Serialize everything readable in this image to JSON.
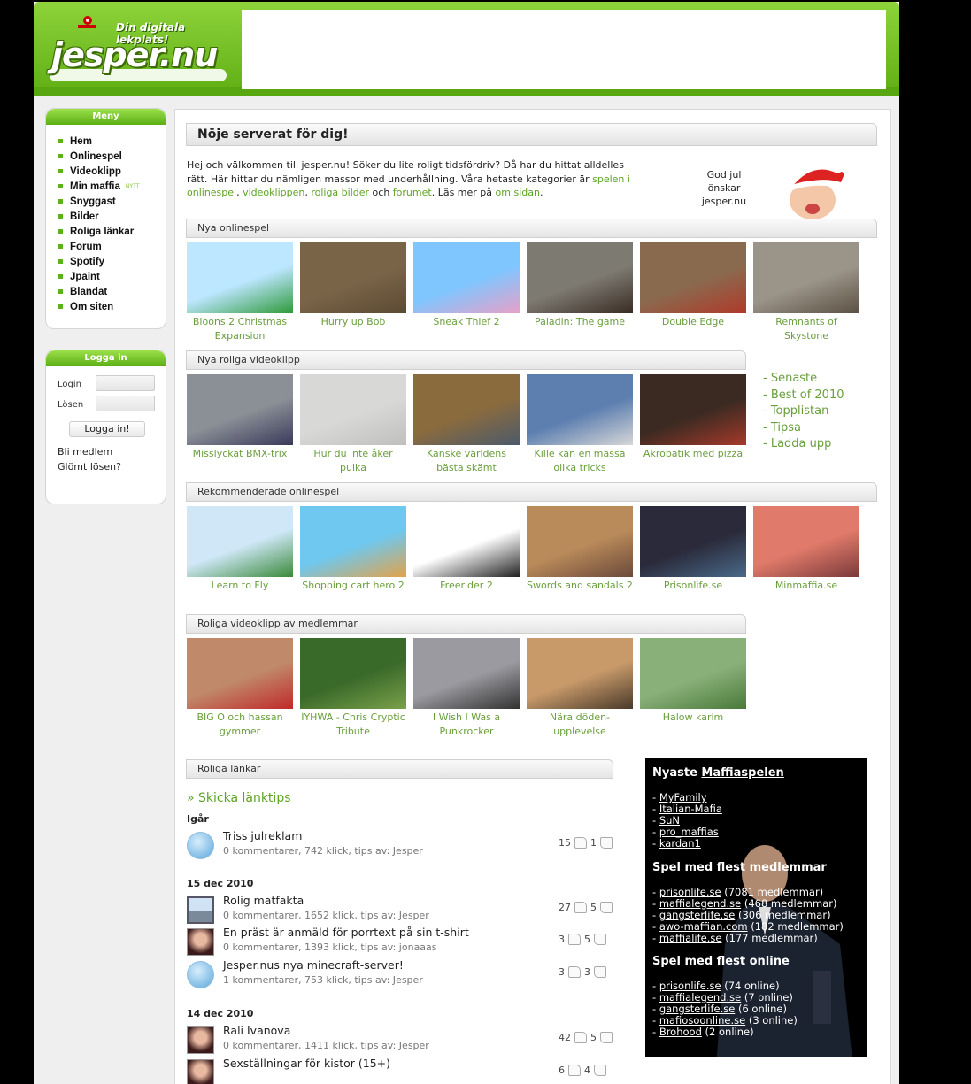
{
  "header": {
    "tagline": "Din digitala lekplats!",
    "logo_text": "jesper.nu"
  },
  "menu": {
    "title": "Meny",
    "items": [
      {
        "label": "Hem"
      },
      {
        "label": "Onlinespel"
      },
      {
        "label": "Videoklipp"
      },
      {
        "label": "Min maffia",
        "badge": "NYTT"
      },
      {
        "label": "Snyggast"
      },
      {
        "label": "Bilder"
      },
      {
        "label": "Roliga länkar"
      },
      {
        "label": "Forum"
      },
      {
        "label": "Spotify"
      },
      {
        "label": "Jpaint"
      },
      {
        "label": "Blandat"
      },
      {
        "label": "Om siten"
      }
    ]
  },
  "login": {
    "title": "Logga in",
    "login_label": "Login",
    "password_label": "Lösen",
    "submit": "Logga in!",
    "register": "Bli medlem",
    "forgot": "Glömt lösen?"
  },
  "main": {
    "title": "Nöje serverat för dig!",
    "intro_text_1": "Hej och välkommen till jesper.nu! Söker du lite roligt tidsfördriv? Då har du hittat alldelles rätt. Här hittar du nämligen massor med underhållning. Våra hetaste kategorier är ",
    "intro_links": [
      "spelen i onlinespel",
      "videoklippen",
      "roliga bilder",
      "forumet",
      "om sidan"
    ],
    "intro_sep_1": ", ",
    "intro_sep_2": ", ",
    "intro_sep_3": " och ",
    "intro_text_2": ". Läs mer på ",
    "intro_text_3": ".",
    "xmas_line1": "God jul",
    "xmas_line2": "önskar",
    "xmas_line3": "jesper.nu"
  },
  "sections": {
    "new_games": {
      "title": "Nya onlinespel",
      "items": [
        "Bloons 2 Christmas Expansion",
        "Hurry up Bob",
        "Sneak Thief 2",
        "Paladin: The game",
        "Double Edge",
        "Remnants of Skystone"
      ]
    },
    "new_videos": {
      "title": "Nya roliga videoklipp",
      "items": [
        "Misslyckat BMX-trix",
        "Hur du inte åker pulka",
        "Kanske världens bästa skämt",
        "Kille kan en massa olika tricks",
        "Akrobatik med pizza"
      ]
    },
    "recommended": {
      "title": "Rekommenderade onlinespel",
      "items": [
        "Learn to Fly",
        "Shopping cart hero 2",
        "Freerider 2",
        "Swords and sandals 2",
        "Prisonlife.se",
        "Minmaffia.se"
      ]
    },
    "member_videos": {
      "title": "Roliga videoklipp av medlemmar",
      "items": [
        "BIG O och hassan gymmer",
        "IYHWA - Chris Cryptic Tribute",
        "I Wish I Was a Punkrocker",
        "Nära döden-upplevelse",
        "Halow karim"
      ]
    }
  },
  "video_links": [
    "- Senaste",
    "- Best of 2010",
    "- Topplistan",
    "- Tipsa",
    "- Ladda upp"
  ],
  "links": {
    "title": "Roliga länkar",
    "tip": "» Skicka länktips",
    "days": [
      {
        "label": "Igår",
        "items": [
          {
            "title": "Triss julreklam",
            "meta": "0 kommentarer, 742 klick, tips av: Jesper",
            "up": "15",
            "down": "1",
            "icon": "globe"
          }
        ]
      },
      {
        "label": "15 dec 2010",
        "items": [
          {
            "title": "Rolig matfakta",
            "meta": "0 kommentarer, 1652 klick, tips av: Jesper",
            "up": "27",
            "down": "5",
            "icon": "picture"
          },
          {
            "title": "En präst är anmäld för porrtext på sin t-shirt",
            "meta": "0 kommentarer, 1393 klick, tips av: jonaaas",
            "up": "3",
            "down": "5",
            "icon": "avatar"
          },
          {
            "title": "Jesper.nus nya minecraft-server!",
            "meta": "1 kommentarer, 753 klick, tips av: Jesper",
            "up": "3",
            "down": "3",
            "icon": "globe"
          }
        ]
      },
      {
        "label": "14 dec 2010",
        "items": [
          {
            "title": "Rali Ivanova",
            "meta": "0 kommentarer, 1411 klick, tips av: Jesper",
            "up": "42",
            "down": "5",
            "icon": "avatar"
          },
          {
            "title": "Sexställningar för kistor (15+)",
            "meta": "",
            "up": "6",
            "down": "4",
            "icon": "avatar"
          }
        ]
      }
    ]
  },
  "maffia": {
    "title_prefix": "Nyaste ",
    "title_link": "Maffiaspelen",
    "newest": [
      "MyFamily",
      "Italian-Mafia",
      "SuN",
      "pro_maffias",
      "kardan1"
    ],
    "most_members_title": "Spel med flest medlemmar",
    "most_members": [
      {
        "name": "prisonlife.se",
        "count": " (7081 medlemmar)"
      },
      {
        "name": "maffialegend.se",
        "count": " (468 medlemmar)"
      },
      {
        "name": "gangsterlife.se",
        "count": " (306 medlemmar)"
      },
      {
        "name": "awo-maffian.com",
        "count": " (182 medlemmar)"
      },
      {
        "name": "maffialife.se",
        "count": " (177 medlemmar)"
      }
    ],
    "most_online_title": "Spel med flest online",
    "most_online": [
      {
        "name": "prisonlife.se",
        "count": " (74 online)"
      },
      {
        "name": "maffialegend.se",
        "count": " (7 online)"
      },
      {
        "name": "gangsterlife.se",
        "count": " (6 online)"
      },
      {
        "name": "mafiosoonline.se",
        "count": " (3 online)"
      },
      {
        "name": "Brohood",
        "count": " (2 online)"
      }
    ]
  },
  "colors": {
    "brand_green": "#5fae14",
    "link_green": "#6a9e3c",
    "background": "#000000"
  }
}
